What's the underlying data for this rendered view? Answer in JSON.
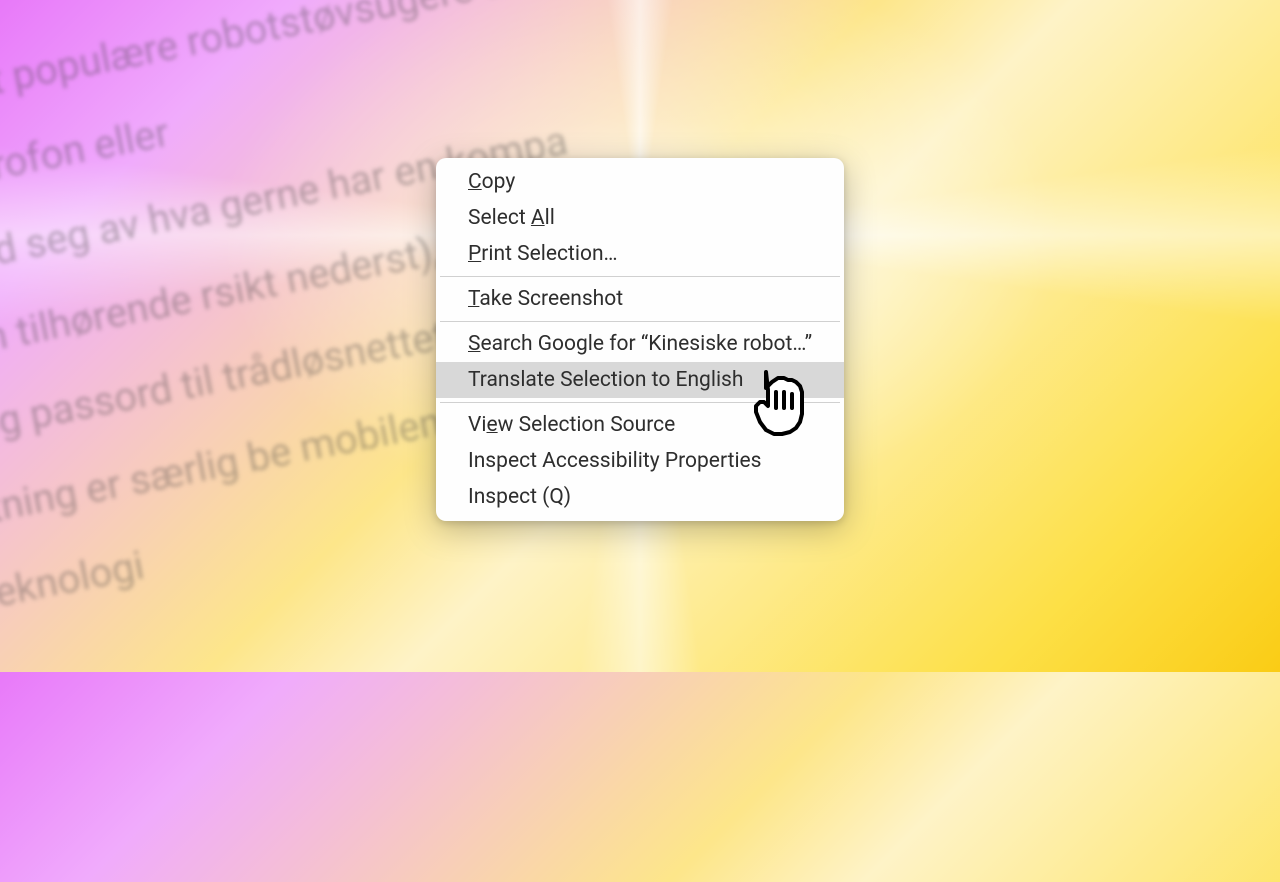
{
  "background": {
    "lines": [
      "de mest populære robotstøvsugere til kinesiske",
      "ar, mikrofon eller",
      "få med seg av hva gerne har en kompa",
      "gir en tilhørende rsikt nederst), ka",
      "yn og passord til trådløsnettet ditt. Særli",
      "tretning er særlig be mobilen og",
      "r-teknologi"
    ]
  },
  "menu": {
    "copy": {
      "prefix": "C",
      "rest": "opy"
    },
    "selectAll": {
      "prefix": "Select ",
      "mid": "A",
      "rest": "ll"
    },
    "printSelection": {
      "prefix": "P",
      "rest": "rint Selection…"
    },
    "takeScreenshot": {
      "prefix": "T",
      "rest": "ake Screenshot"
    },
    "searchGoogle": {
      "prefix": "S",
      "rest": "earch Google for “Kinesiske robot…”"
    },
    "translate": "Translate Selection to English",
    "viewSource": {
      "prefix": "Vi",
      "mid": "e",
      "rest": "w Selection Source"
    },
    "inspectA11y": "Inspect Accessibility Properties",
    "inspect": "Inspect (Q)"
  }
}
